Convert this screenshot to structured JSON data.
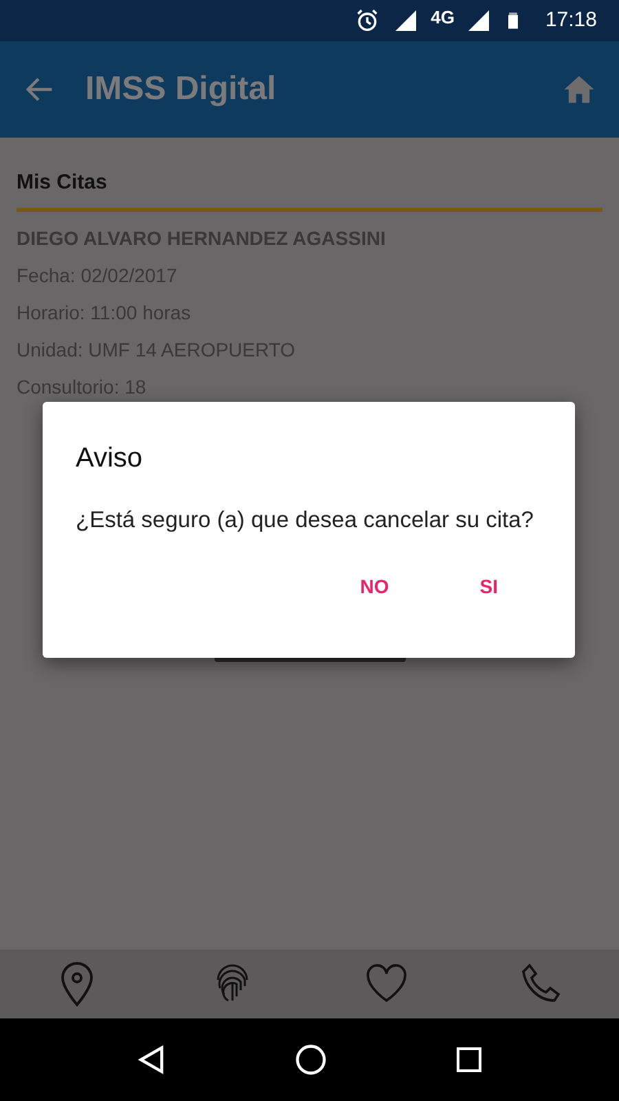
{
  "status_bar": {
    "network": "4G",
    "time": "17:18"
  },
  "app_bar": {
    "title": "IMSS Digital"
  },
  "section": {
    "title": "Mis Citas"
  },
  "appointment": {
    "patient": "DIEGO ALVARO HERNANDEZ AGASSINI",
    "fields": [
      "Fecha: 02/02/2017",
      "Horario: 11:00 horas",
      "Unidad: UMF 14 AEROPUERTO",
      "Consultorio: 18"
    ]
  },
  "dialog": {
    "title": "Aviso",
    "message": "¿Está seguro (a) que desea cancelar su cita?",
    "buttons": [
      "NO",
      "SI"
    ]
  },
  "bottom_nav": [
    {
      "kind": "location"
    },
    {
      "kind": "fingerprint"
    },
    {
      "kind": "heart"
    },
    {
      "kind": "phone"
    }
  ]
}
